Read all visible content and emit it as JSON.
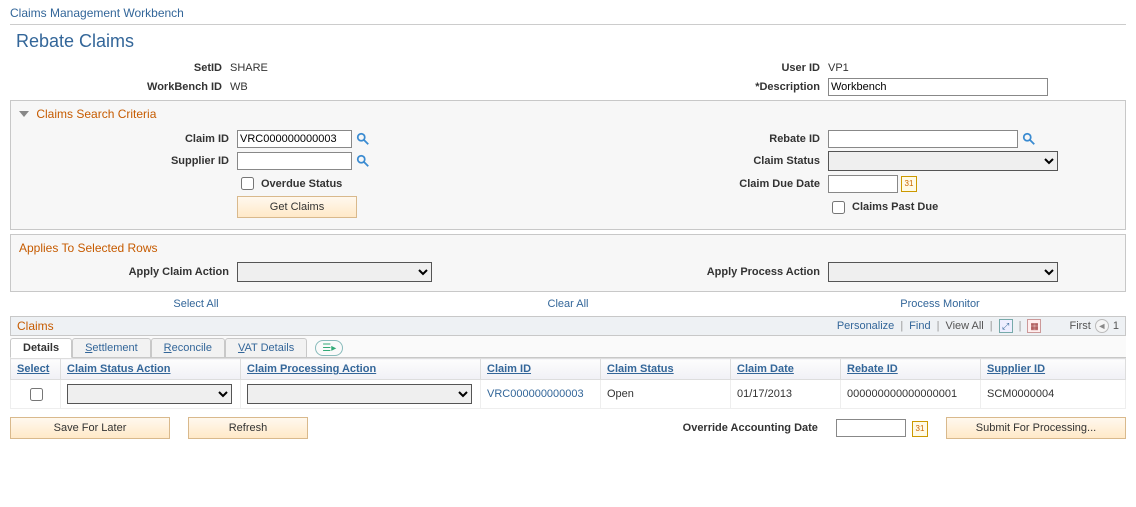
{
  "breadcrumb": "Claims Management Workbench",
  "page_title": "Rebate Claims",
  "header": {
    "setid_label": "SetID",
    "setid_value": "SHARE",
    "userid_label": "User ID",
    "userid_value": "VP1",
    "workbenchid_label": "WorkBench ID",
    "workbenchid_value": "WB",
    "description_label": "*Description",
    "description_value": "Workbench"
  },
  "search": {
    "title": "Claims Search Criteria",
    "claim_id_label": "Claim ID",
    "claim_id_value": "VRC000000000003",
    "supplier_id_label": "Supplier ID",
    "supplier_id_value": "",
    "overdue_status_label": "Overdue Status",
    "overdue_status_checked": false,
    "get_claims_label": "Get Claims",
    "rebate_id_label": "Rebate ID",
    "rebate_id_value": "",
    "claim_status_label": "Claim Status",
    "claim_status_value": "",
    "claim_due_date_label": "Claim Due Date",
    "claim_due_date_value": "",
    "claims_past_due_label": "Claims Past Due",
    "claims_past_due_checked": false
  },
  "applies": {
    "title": "Applies To Selected Rows",
    "apply_claim_action_label": "Apply Claim Action",
    "apply_claim_action_value": "",
    "apply_process_action_label": "Apply Process Action",
    "apply_process_action_value": "",
    "select_all_label": "Select All",
    "clear_all_label": "Clear All",
    "process_monitor_label": "Process Monitor"
  },
  "grid": {
    "title": "Claims",
    "personalize_label": "Personalize",
    "find_label": "Find",
    "view_all_label": "View All",
    "first_label": "First",
    "row_info_prefix": "1",
    "tabs": {
      "details": "Details",
      "settlement": "Settlement",
      "reconcile": "Reconcile",
      "vat_details": "VAT Details"
    },
    "columns": {
      "select": "Select",
      "claim_status_action": "Claim Status Action",
      "claim_processing_action": "Claim Processing Action",
      "claim_id": "Claim ID",
      "claim_status": "Claim Status",
      "claim_date": "Claim Date",
      "rebate_id": "Rebate ID",
      "supplier_id": "Supplier ID"
    },
    "rows": [
      {
        "select": false,
        "claim_status_action": "",
        "claim_processing_action": "",
        "claim_id": "VRC000000000003",
        "claim_status": "Open",
        "claim_date": "01/17/2013",
        "rebate_id": "000000000000000001",
        "supplier_id": "SCM0000004"
      }
    ]
  },
  "footer": {
    "save_for_later_label": "Save For Later",
    "refresh_label": "Refresh",
    "override_accounting_date_label": "Override Accounting Date",
    "override_accounting_date_value": "",
    "submit_label": "Submit For Processing..."
  }
}
